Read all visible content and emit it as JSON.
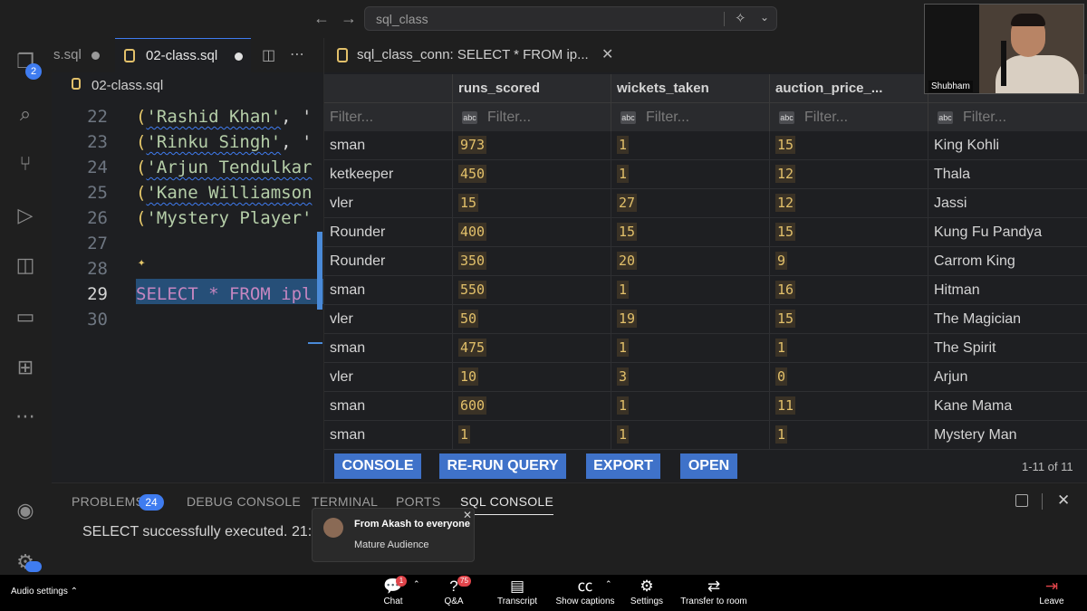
{
  "titlebar": {
    "search": "sql_class"
  },
  "activity": {
    "explorer_badge": "2"
  },
  "editor": {
    "tabs": [
      {
        "label": "s.sql"
      },
      {
        "label": "02-class.sql"
      }
    ],
    "breadcrumb": "02-class.sql",
    "lines": [
      {
        "num": "22",
        "name": "'Rashid Khan'",
        "tail": ", '"
      },
      {
        "num": "23",
        "name": "'Rinku Singh'",
        "tail": ", '"
      },
      {
        "num": "24",
        "name": "'Arjun Tendulkar",
        "tail": ""
      },
      {
        "num": "25",
        "name": "'Kane Williamson",
        "tail": ""
      },
      {
        "num": "26",
        "name": "'Mystery Player'",
        "tail": ""
      },
      {
        "num": "27",
        "name": "",
        "tail": ""
      },
      {
        "num": "28",
        "name": "",
        "tail": ""
      },
      {
        "num": "29",
        "name": "SELECT * FROM ipl",
        "tail": ""
      },
      {
        "num": "30",
        "name": "",
        "tail": ""
      }
    ]
  },
  "results": {
    "tab_label": "sql_class_conn: SELECT * FROM ip...",
    "columns": [
      "",
      "runs_scored",
      "wickets_taken",
      "auction_price_...",
      ""
    ],
    "filter_placeholder": "Filter...",
    "rows": [
      [
        "sman",
        "973",
        "1",
        "15",
        "King Kohli"
      ],
      [
        "ketkeeper",
        "450",
        "1",
        "12",
        "Thala"
      ],
      [
        "vler",
        "15",
        "27",
        "12",
        "Jassi"
      ],
      [
        "Rounder",
        "400",
        "15",
        "15",
        "Kung Fu Pandya"
      ],
      [
        "Rounder",
        "350",
        "20",
        "9",
        "Carrom King"
      ],
      [
        "sman",
        "550",
        "1",
        "16",
        "Hitman"
      ],
      [
        "vler",
        "50",
        "19",
        "15",
        "The Magician"
      ],
      [
        "sman",
        "475",
        "1",
        "1",
        "The Spirit"
      ],
      [
        "vler",
        "10",
        "3",
        "0",
        "Arjun"
      ],
      [
        "sman",
        "600",
        "1",
        "11",
        "Kane Mama"
      ],
      [
        "sman",
        "1",
        "1",
        "1",
        "Mystery Man"
      ]
    ],
    "buttons": [
      "CONSOLE",
      "RE-RUN QUERY",
      "EXPORT",
      "OPEN"
    ],
    "count": "1-11 of 11"
  },
  "panel": {
    "tabs": [
      "PROBLEMS",
      "DEBUG CONSOLE",
      "TERMINAL",
      "PORTS",
      "SQL CONSOLE"
    ],
    "problems_count": "24",
    "message": "SELECT successfully executed.",
    "time": "21:5"
  },
  "toast": {
    "from": "From Akash to everyone",
    "message": "Mature Audience"
  },
  "video": {
    "name": "Shubham"
  },
  "meeting": {
    "audio": "Audio settings",
    "chat": "Chat",
    "chat_badge": "1",
    "qa": "Q&A",
    "qa_badge": "75",
    "transcript": "Transcript",
    "captions": "Show captions",
    "settings": "Settings",
    "transfer": "Transfer to room",
    "leave": "Leave"
  }
}
